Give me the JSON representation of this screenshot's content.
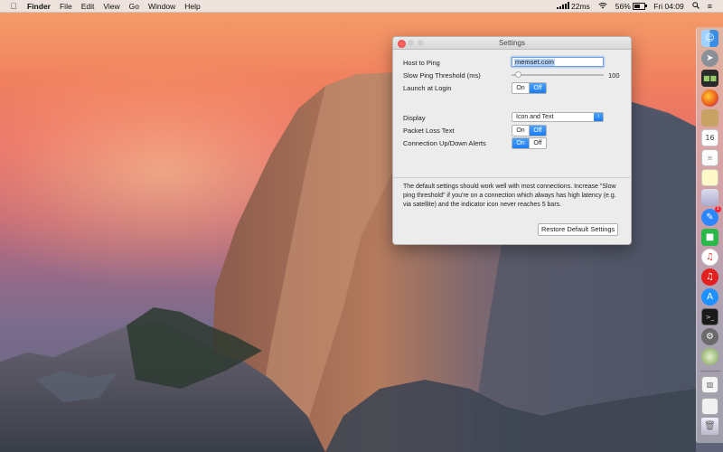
{
  "menubar": {
    "app_name": "Finder",
    "menus": [
      "File",
      "Edit",
      "View",
      "Go",
      "Window",
      "Help"
    ],
    "ping": "22ms",
    "battery": "56%",
    "battery_level": 0.56,
    "clock": "Fri 04:09"
  },
  "window": {
    "title": "Settings",
    "host_label": "Host to Ping",
    "host_value": "memset.com",
    "threshold_label": "Slow Ping Threshold (ms)",
    "threshold_value": "100",
    "threshold_fraction": 0.04,
    "launch_label": "Launch at Login",
    "launch_on": "On",
    "launch_off": "Off",
    "launch_selected": "Off",
    "display_label": "Display",
    "display_value": "Icon and Text",
    "packet_label": "Packet Loss Text",
    "packet_on": "On",
    "packet_off": "Off",
    "packet_selected": "Off",
    "conn_label": "Connection Up/Down Alerts",
    "conn_on": "On",
    "conn_off": "Off",
    "conn_selected": "On",
    "description": "The default settings should work well with most connections. Increase \"Slow ping threshold\" if you're on a connection which always has high latency (e.g. via satellite) and the indicator icon never reaches 5 bars.",
    "restore_button": "Restore Default Settings"
  },
  "dock": {
    "calendar_day": "16",
    "messages_badge": "1",
    "icons": [
      "finder-icon",
      "launchpad-icon",
      "dashboard-icon",
      "firefox-icon",
      "notes-icon",
      "calendar-icon",
      "textedit-icon",
      "preview-icon",
      "messages-icon",
      "facetime-icon",
      "itunes-icon",
      "app-store-icon",
      "terminal-icon",
      "system-preferences-icon",
      "browser-icon",
      "document-icon",
      "network-icon",
      "trash-icon"
    ]
  }
}
